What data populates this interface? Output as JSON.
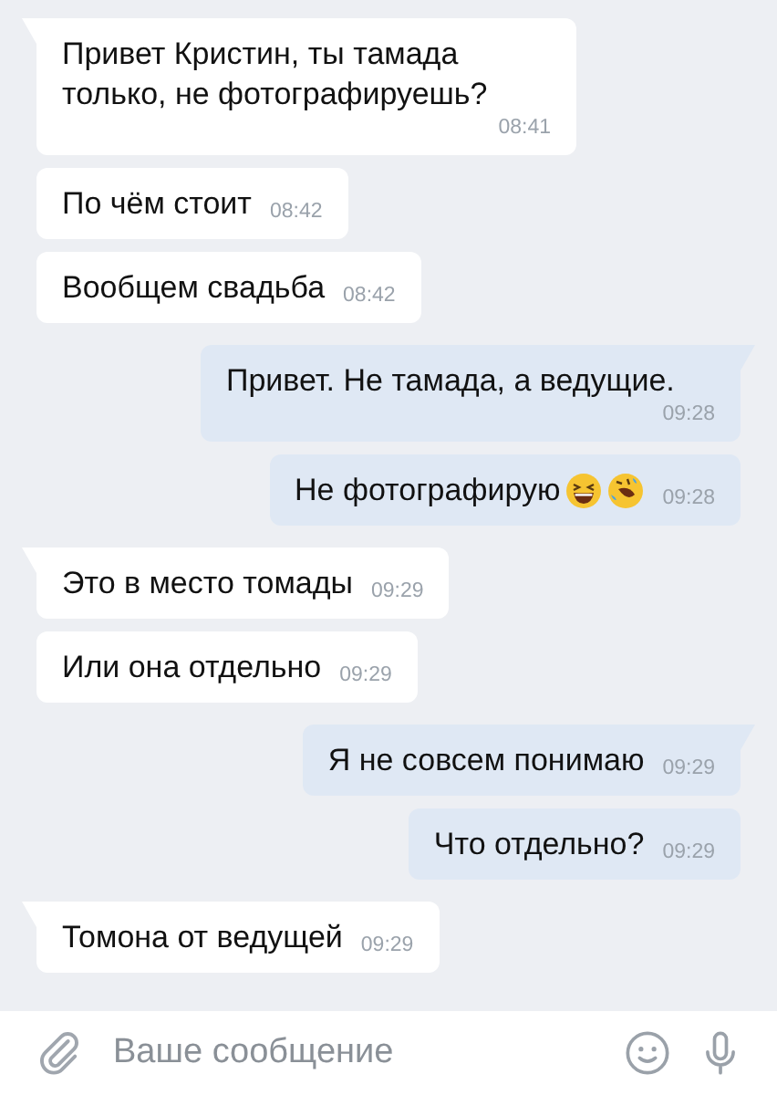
{
  "messages": [
    {
      "kind": "in",
      "tail": true,
      "text": "Привет Кристин, ты тамада только, не фотографируешь?",
      "time": "08:41"
    },
    {
      "kind": "in",
      "tail": false,
      "text": "По чём стоит",
      "time": "08:42"
    },
    {
      "kind": "in",
      "tail": false,
      "text": "Вообщем свадьба",
      "time": "08:42"
    },
    {
      "kind": "out",
      "tail": true,
      "text": "Привет. Не тамада, а ведущие.",
      "time": "09:28"
    },
    {
      "kind": "out",
      "tail": false,
      "text": "Не фотографирую",
      "emojis": [
        {
          "kind": "grin"
        },
        {
          "kind": "rofl"
        }
      ],
      "time": "09:28"
    },
    {
      "kind": "in",
      "tail": true,
      "text": "Это в место томады",
      "time": "09:29"
    },
    {
      "kind": "in",
      "tail": false,
      "text": "Или она отдельно",
      "time": "09:29"
    },
    {
      "kind": "out",
      "tail": true,
      "text": "Я не совсем понимаю",
      "time": "09:29"
    },
    {
      "kind": "out",
      "tail": false,
      "text": "Что отдельно?",
      "time": "09:29"
    },
    {
      "kind": "in",
      "tail": true,
      "text": "Томона от ведущей",
      "time": "09:29"
    }
  ],
  "composer": {
    "placeholder": "Ваше сообщение"
  }
}
